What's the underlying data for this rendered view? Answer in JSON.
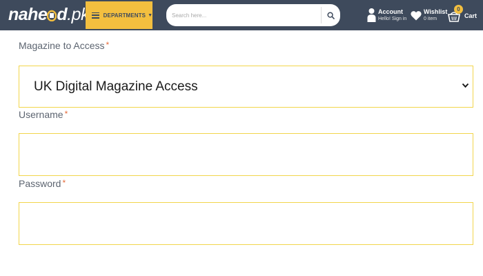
{
  "header": {
    "logo_text": "nahe",
    "logo_text_2": "d",
    "logo_suffix": ".pk",
    "departments_label": "DEPARTMENTS",
    "search": {
      "placeholder": "Search here..."
    },
    "account": {
      "title": "Account",
      "subtitle": "Hello! Sign in"
    },
    "wishlist": {
      "title": "Wishlist",
      "subtitle": "0 item"
    },
    "cart": {
      "label": "Cart",
      "count": "0"
    },
    "colors": {
      "bar": "#3e4a5c",
      "accent": "#f3bf3f"
    }
  },
  "form": {
    "magazine": {
      "label": "Magazine to Access",
      "required_mark": "*",
      "selected_value": "UK Digital Magazine Access"
    },
    "username": {
      "label": "Username",
      "required_mark": "*",
      "value": ""
    },
    "password": {
      "label": "Password",
      "required_mark": "*",
      "value": ""
    },
    "colors": {
      "field_border": "#f2d54a",
      "required": "#e56b3a"
    }
  }
}
